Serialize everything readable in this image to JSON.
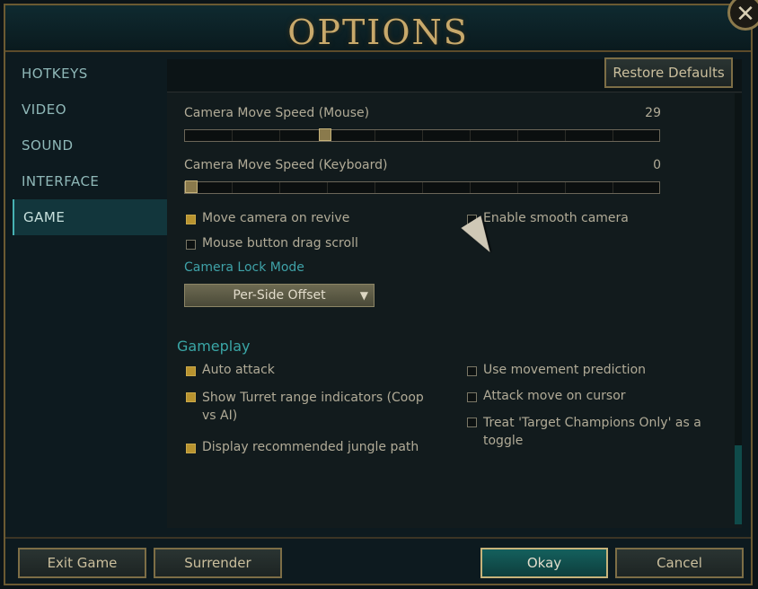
{
  "window": {
    "title": "OPTIONS",
    "close_glyph": "✕"
  },
  "nav": {
    "items": [
      {
        "label": "HOTKEYS"
      },
      {
        "label": "VIDEO"
      },
      {
        "label": "SOUND"
      },
      {
        "label": "INTERFACE"
      },
      {
        "label": "GAME",
        "active": true
      }
    ]
  },
  "toolbar": {
    "restore_defaults": "Restore Defaults"
  },
  "camera": {
    "mouse_speed": {
      "label": "Camera Move Speed (Mouse)",
      "value": "29"
    },
    "keyboard_speed": {
      "label": "Camera Move Speed (Keyboard)",
      "value": "0"
    },
    "move_on_revive": {
      "label": "Move camera on revive",
      "checked": true
    },
    "smooth_camera": {
      "label": "Enable smooth camera",
      "checked": false
    },
    "drag_scroll": {
      "label": "Mouse button drag scroll",
      "checked": false
    },
    "lock_mode": {
      "label": "Camera Lock Mode",
      "selected": "Per-Side Offset",
      "arrow": "▼"
    }
  },
  "gameplay": {
    "title": "Gameplay",
    "auto_attack": {
      "label": "Auto attack",
      "checked": true
    },
    "turret_range": {
      "label": "Show Turret range indicators (Coop vs AI)",
      "checked": true
    },
    "jungle_path": {
      "label": "Display recommended jungle path",
      "checked": true
    },
    "movement_prediction": {
      "label": "Use movement prediction",
      "checked": false
    },
    "attack_move": {
      "label": "Attack move on cursor",
      "checked": false
    },
    "target_champions": {
      "label": "Treat 'Target Champions Only' as a toggle",
      "checked": false
    }
  },
  "footer": {
    "exit": "Exit Game",
    "surrender": "Surrender",
    "okay": "Okay",
    "cancel": "Cancel"
  },
  "colors": {
    "accent": "#47b2b3",
    "gold": "#c8a96b",
    "checked": "#b8932f"
  }
}
